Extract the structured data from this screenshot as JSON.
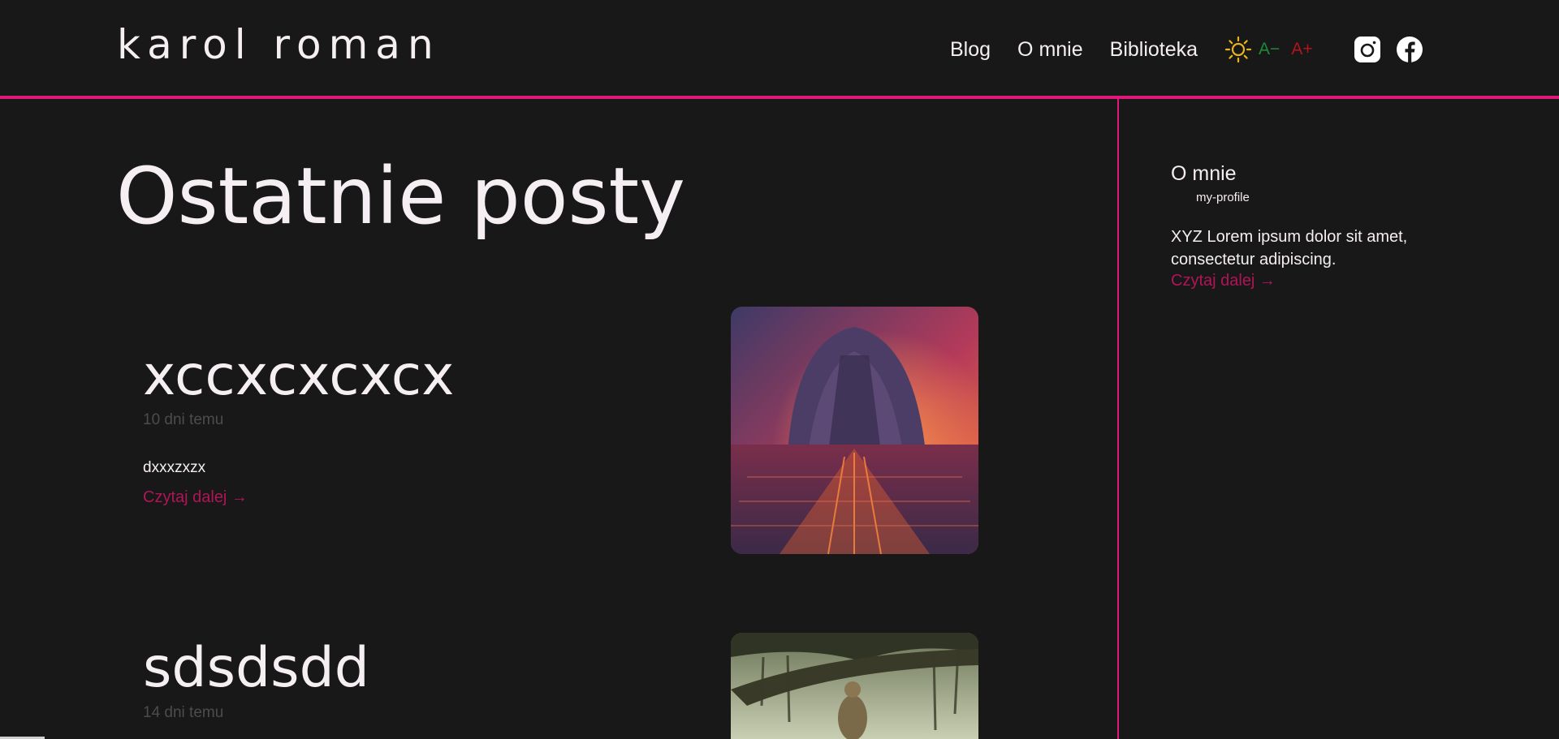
{
  "site": {
    "brand": "karol roman"
  },
  "nav": {
    "items": [
      "Blog",
      "O mnie",
      "Biblioteka"
    ],
    "font_decrease": "A−",
    "font_increase": "A+",
    "theme_icon": "sun-icon",
    "social_icons": [
      "instagram-icon",
      "facebook-icon"
    ]
  },
  "colors": {
    "background": "#181818",
    "accent": "#e0187a",
    "link": "#b01558",
    "font_minus": "#1d8a3a",
    "font_plus": "#b3141f",
    "sun": "#e9b31b"
  },
  "main": {
    "title": "Ostatnie posty",
    "posts": [
      {
        "title": "xccxcxcxcx",
        "date": "10 dni temu",
        "excerpt": "dxxxzxzx",
        "read_more": "Czytaj dalej →"
      },
      {
        "title": "sdsdsdd",
        "date": "14 dni temu"
      }
    ]
  },
  "sidebar": {
    "title": "O mnie",
    "profile": "my-profile",
    "text": "XYZ Lorem ipsum dolor sit amet, consectetur adipiscing.",
    "read_more": "Czytaj dalej →"
  }
}
